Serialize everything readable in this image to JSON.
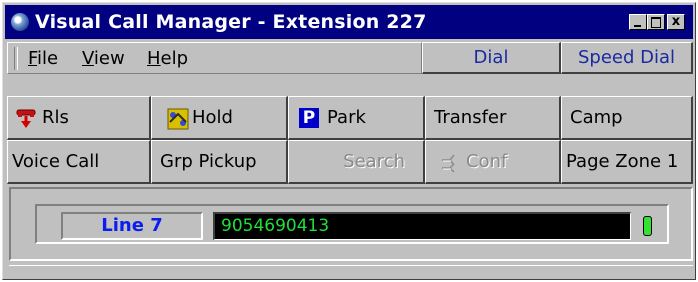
{
  "window": {
    "title": "Visual Call Manager - Extension 227",
    "close_glyph": "x"
  },
  "menu": {
    "items": [
      {
        "underline": "F",
        "rest": "ile"
      },
      {
        "underline": "V",
        "rest": "iew"
      },
      {
        "underline": "H",
        "rest": "elp"
      }
    ]
  },
  "toolbar": {
    "dial_label": "Dial",
    "speed_dial_label": "Speed Dial",
    "release_label": "Rls",
    "hold_label": "Hold",
    "park_icon_letter": "P",
    "park_label": "Park",
    "transfer_label": "Transfer",
    "camp_label": "Camp",
    "voice_call_label": "Voice Call",
    "grp_pickup_label": "Grp Pickup",
    "search_label": "Search",
    "conf_label": "Conf",
    "page_zone_label": "Page Zone 1"
  },
  "line": {
    "label": "Line 7",
    "number": "9054690413"
  },
  "icons": {
    "app": "app-globe-icon",
    "release": "phone-release-icon",
    "hold": "hold-icon",
    "park": "park-icon",
    "conf": "conference-icon",
    "status": "line-status-led-icon"
  },
  "colors": {
    "titlebar": "#000080",
    "face": "#c0c0c0",
    "line_label_text": "#0a1ef0",
    "display_bg": "#000000",
    "display_text": "#1ee03a",
    "led": "#33e233",
    "park_icon": "#0000c8"
  }
}
